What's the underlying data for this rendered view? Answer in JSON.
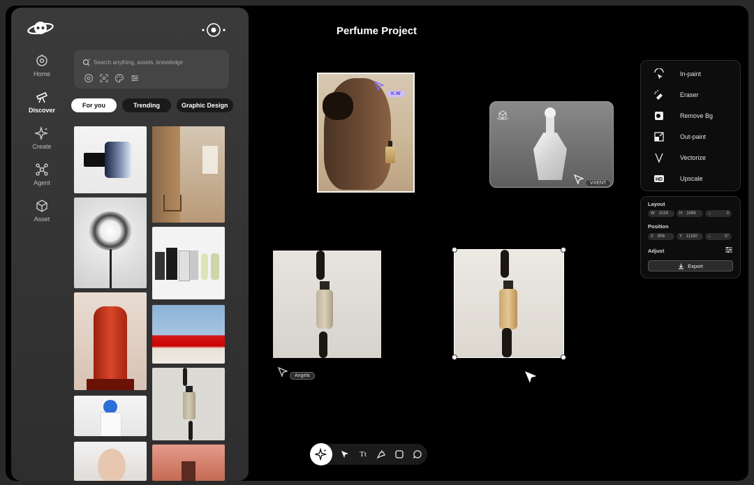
{
  "project": {
    "title": "Perfume Project"
  },
  "nav": {
    "items": [
      {
        "label": "Home"
      },
      {
        "label": "Discover"
      },
      {
        "label": "Create"
      },
      {
        "label": "Agent"
      },
      {
        "label": "Asset"
      }
    ]
  },
  "search": {
    "placeholder": "Search anything, assets, knowledge"
  },
  "tabs": [
    {
      "label": "For you"
    },
    {
      "label": "Trending"
    },
    {
      "label": "Graphic Design"
    }
  ],
  "cursors": {
    "kw": "K.W",
    "vxent": "VXENT",
    "angela": "Angela"
  },
  "tools": {
    "items": [
      {
        "label": "In-paint",
        "icon": "inpaint-icon"
      },
      {
        "label": "Eraser",
        "icon": "eraser-icon"
      },
      {
        "label": "Remove Bg",
        "icon": "remove-bg-icon"
      },
      {
        "label": "Out-paint",
        "icon": "outpaint-icon"
      },
      {
        "label": "Vectorize",
        "icon": "vectorize-icon"
      },
      {
        "label": "Upscale",
        "icon": "hd-icon"
      }
    ]
  },
  "properties": {
    "layout_label": "Layout",
    "w_label": "W",
    "w_value": "1024",
    "h_label": "H",
    "h_value": "1086",
    "corner_label": "∟",
    "corner_value": "0",
    "position_label": "Position",
    "x_label": "X",
    "x_value": "856",
    "y_label": "Y",
    "y_value": "11180",
    "angle_label": "∟",
    "angle_value": "0°",
    "adjust_label": "Adjust",
    "export_label": "Export"
  },
  "toolbar": {
    "text_tool": "Tt"
  },
  "colors": {
    "accent_purple": "#8b6cff",
    "panel_bg": "#333333",
    "canvas_bg": "#000000"
  }
}
